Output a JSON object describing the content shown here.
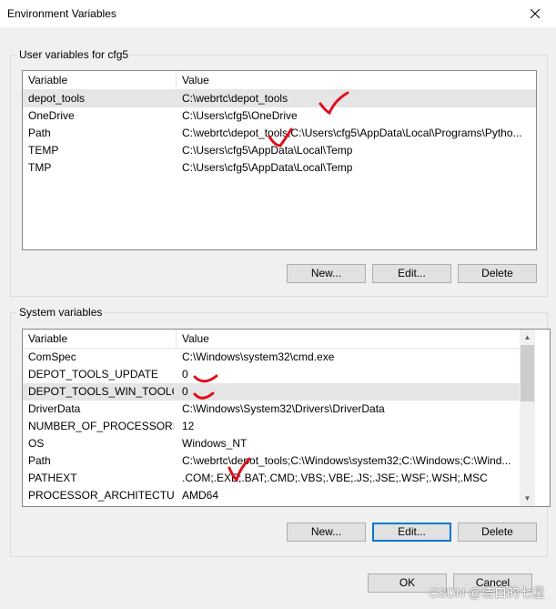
{
  "window": {
    "title": "Environment Variables",
    "close_glyph": "close-icon"
  },
  "user_vars": {
    "legend": "User variables for cfg5",
    "columns": [
      "Variable",
      "Value"
    ],
    "rows": [
      {
        "name": "depot_tools",
        "value": "C:\\webrtc\\depot_tools"
      },
      {
        "name": "OneDrive",
        "value": "C:\\Users\\cfg5\\OneDrive"
      },
      {
        "name": "Path",
        "value": "C:\\webrtc\\depot_tools;C:\\Users\\cfg5\\AppData\\Local\\Programs\\Pytho..."
      },
      {
        "name": "TEMP",
        "value": "C:\\Users\\cfg5\\AppData\\Local\\Temp"
      },
      {
        "name": "TMP",
        "value": "C:\\Users\\cfg5\\AppData\\Local\\Temp"
      }
    ],
    "buttons": {
      "new": "New...",
      "edit": "Edit...",
      "delete": "Delete"
    }
  },
  "system_vars": {
    "legend": "System variables",
    "columns": [
      "Variable",
      "Value"
    ],
    "rows": [
      {
        "name": "ComSpec",
        "value": "C:\\Windows\\system32\\cmd.exe"
      },
      {
        "name": "DEPOT_TOOLS_UPDATE",
        "value": "0"
      },
      {
        "name": "DEPOT_TOOLS_WIN_TOOLC...",
        "value": "0"
      },
      {
        "name": "DriverData",
        "value": "C:\\Windows\\System32\\Drivers\\DriverData"
      },
      {
        "name": "NUMBER_OF_PROCESSORS",
        "value": "12"
      },
      {
        "name": "OS",
        "value": "Windows_NT"
      },
      {
        "name": "Path",
        "value": "C:\\webrtc\\depot_tools;C:\\Windows\\system32;C:\\Windows;C:\\Wind..."
      },
      {
        "name": "PATHEXT",
        "value": ".COM;.EXE;.BAT;.CMD;.VBS;.VBE;.JS;.JSE;.WSF;.WSH;.MSC"
      },
      {
        "name": "PROCESSOR_ARCHITECTURE",
        "value": "AMD64"
      }
    ],
    "buttons": {
      "new": "New...",
      "edit": "Edit...",
      "delete": "Delete"
    }
  },
  "dialog_buttons": {
    "ok": "OK",
    "cancel": "Cancel"
  },
  "watermark": "CSDN @洁白的七星",
  "colors": {
    "annotation": "#e0101c",
    "focus": "#0078d7",
    "selection": "#e5e5e5"
  }
}
